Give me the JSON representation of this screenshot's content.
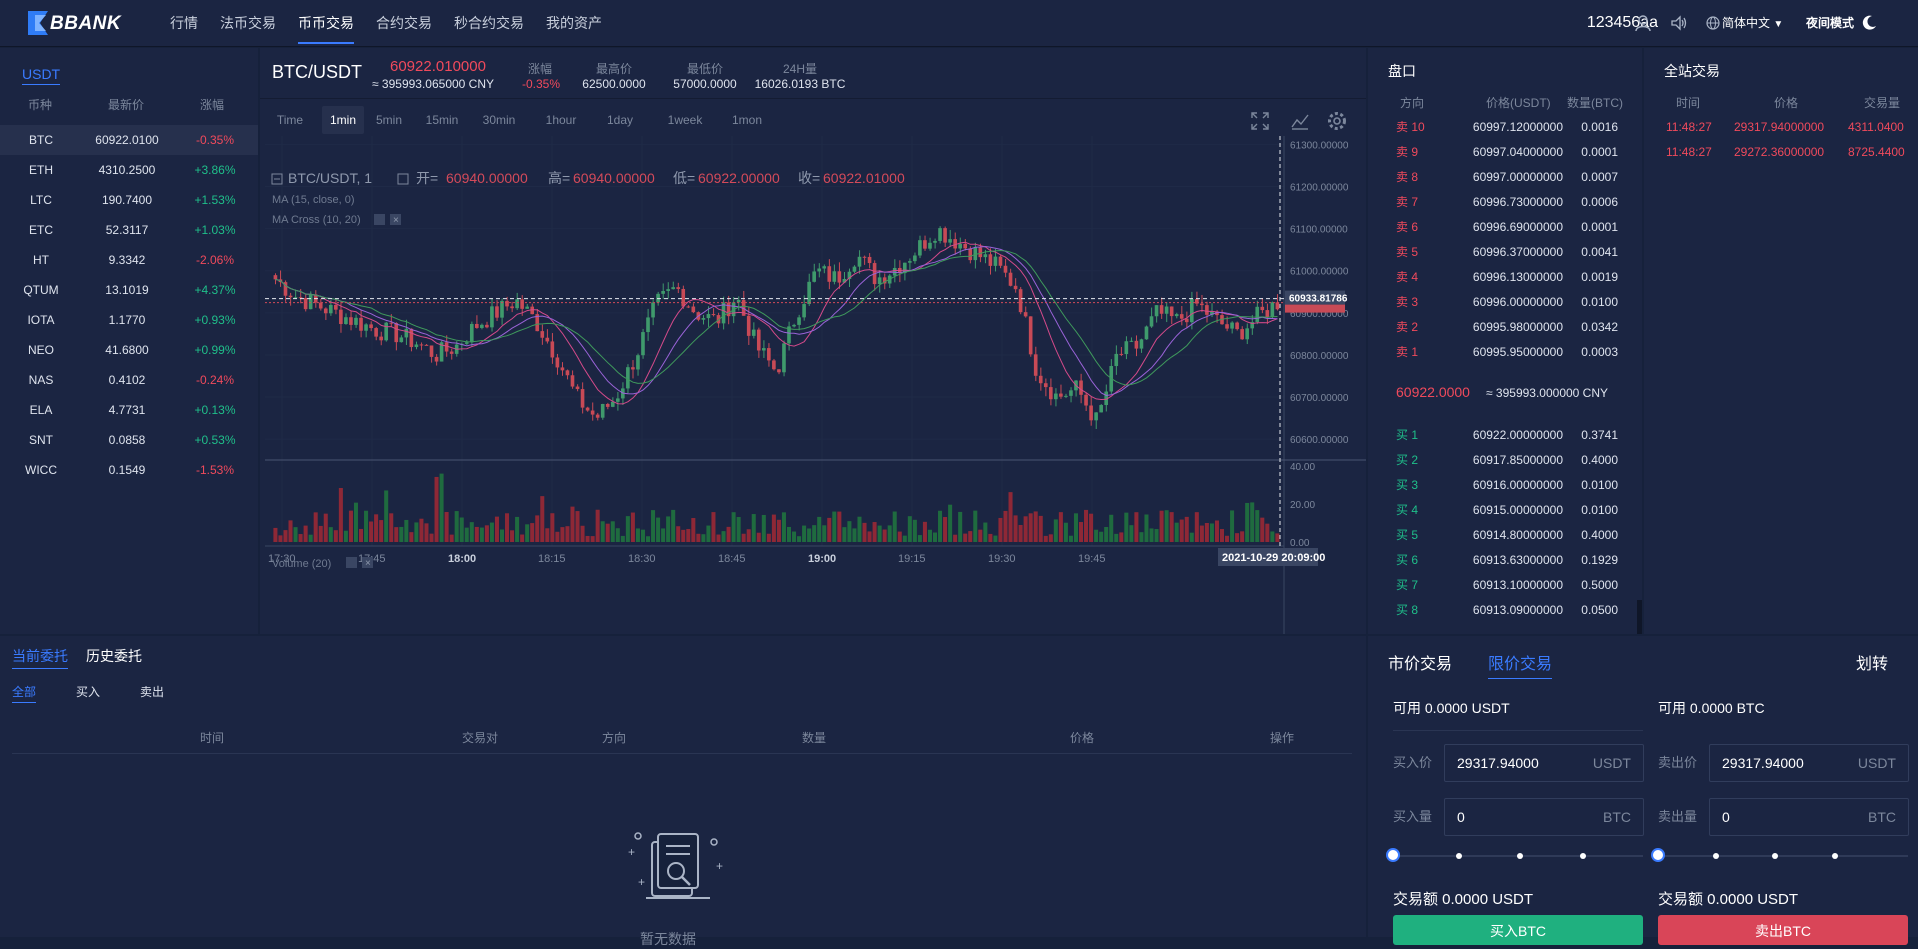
{
  "brand": {
    "name": "BBANK"
  },
  "nav": {
    "items": [
      {
        "label": "行情"
      },
      {
        "label": "法币交易"
      },
      {
        "label": "币币交易"
      },
      {
        "label": "合约交易"
      },
      {
        "label": "秒合约交易"
      },
      {
        "label": "我的资产"
      }
    ],
    "active_index": 2
  },
  "header": {
    "username": "123456aa",
    "language": "简体中文",
    "theme_label": "夜间模式"
  },
  "colors": {
    "up": "#1fbf8a",
    "down": "#f04a5c",
    "accent": "#3a7bff"
  },
  "market_list": {
    "tab": "USDT",
    "columns": [
      "币种",
      "最新价",
      "涨幅"
    ],
    "rows": [
      {
        "symbol": "BTC",
        "price": "60922.0100",
        "change": "-0.35%",
        "dir": "down"
      },
      {
        "symbol": "ETH",
        "price": "4310.2500",
        "change": "+3.86%",
        "dir": "up"
      },
      {
        "symbol": "LTC",
        "price": "190.7400",
        "change": "+1.53%",
        "dir": "up"
      },
      {
        "symbol": "ETC",
        "price": "52.3117",
        "change": "+1.03%",
        "dir": "up"
      },
      {
        "symbol": "HT",
        "price": "9.3342",
        "change": "-2.06%",
        "dir": "down"
      },
      {
        "symbol": "QTUM",
        "price": "13.1019",
        "change": "+4.37%",
        "dir": "up"
      },
      {
        "symbol": "IOTA",
        "price": "1.1770",
        "change": "+0.93%",
        "dir": "up"
      },
      {
        "symbol": "NEO",
        "price": "41.6800",
        "change": "+0.99%",
        "dir": "up"
      },
      {
        "symbol": "NAS",
        "price": "0.4102",
        "change": "-0.24%",
        "dir": "down"
      },
      {
        "symbol": "ELA",
        "price": "4.7731",
        "change": "+0.13%",
        "dir": "up"
      },
      {
        "symbol": "SNT",
        "price": "0.0858",
        "change": "+0.53%",
        "dir": "up"
      },
      {
        "symbol": "WICC",
        "price": "0.1549",
        "change": "-1.53%",
        "dir": "down"
      }
    ]
  },
  "ticker": {
    "pair": "BTC/USDT",
    "price": "60922.010000",
    "price_cny": "≈ 395993.065000 CNY",
    "change_label": "涨幅",
    "change": "-0.35%",
    "high_label": "最高价",
    "high": "62500.0000",
    "low_label": "最低价",
    "low": "57000.0000",
    "volume_label": "24H量",
    "volume": "16026.0193 BTC"
  },
  "timeframes": [
    "Time",
    "1min",
    "5min",
    "15min",
    "30min",
    "1hour",
    "1day",
    "1week",
    "1mon"
  ],
  "timeframe_active": 1,
  "chart_data": {
    "type": "candlestick",
    "legend": {
      "symbol": "BTC/USDT, 1",
      "open_label": "开=",
      "open": "60940.00000",
      "high_label": "高=",
      "high": "60940.00000",
      "low_label": "低=",
      "low": "60922.00000",
      "close_label": "收=",
      "close": "60922.01000",
      "ma_study": "MA (15, close, 0)",
      "ma_cross_study": "MA Cross (10, 20)",
      "volume_study": "Volume (20)"
    },
    "price_axis": [
      "61300.00000",
      "61200.00000",
      "61100.00000",
      "61000.00000",
      "60900.00000",
      "60800.00000",
      "60700.00000",
      "60600.00000"
    ],
    "price_ticks": [
      61300,
      61200,
      61100,
      61000,
      60900,
      60800,
      60700,
      60600
    ],
    "price_range": [
      60560,
      61320
    ],
    "volume_axis": [
      "40.00",
      "20.00",
      "0.00"
    ],
    "volume_ticks": [
      40,
      20,
      0
    ],
    "volume_range": [
      0,
      40
    ],
    "time_axis": [
      "17:30",
      "17:45",
      "18:00",
      "18:15",
      "18:30",
      "18:45",
      "19:00",
      "19:15",
      "19:30",
      "19:45"
    ],
    "crosshair_price": "60933.81786",
    "crosshair_time": "2021-10-29 20:09:00",
    "anchors": [
      60980,
      60940,
      60920,
      60900,
      60880,
      60860,
      60850,
      60830,
      60800,
      60820,
      60870,
      60900,
      60930,
      60880,
      60800,
      60700,
      60650,
      60700,
      60800,
      60920,
      60960,
      60900,
      60880,
      60940,
      60820,
      60760,
      60900,
      61000,
      60980,
      61040,
      60980,
      61010,
      61050,
      61100,
      61070,
      61040,
      61010,
      60960,
      60760,
      60700,
      60720,
      60640,
      60800,
      60820,
      60900,
      60880,
      60920,
      60880,
      60850,
      60890,
      60925
    ]
  },
  "orderbook": {
    "title": "盘口",
    "columns": [
      "方向",
      "价格(USDT)",
      "数量(BTC)"
    ],
    "asks": [
      {
        "side": "卖 10",
        "price": "60997.12000000",
        "amount": "0.0016"
      },
      {
        "side": "卖 9",
        "price": "60997.04000000",
        "amount": "0.0001"
      },
      {
        "side": "卖 8",
        "price": "60997.00000000",
        "amount": "0.0007"
      },
      {
        "side": "卖 7",
        "price": "60996.73000000",
        "amount": "0.0006"
      },
      {
        "side": "卖 6",
        "price": "60996.69000000",
        "amount": "0.0001"
      },
      {
        "side": "卖 5",
        "price": "60996.37000000",
        "amount": "0.0041"
      },
      {
        "side": "卖 4",
        "price": "60996.13000000",
        "amount": "0.0019"
      },
      {
        "side": "卖 3",
        "price": "60996.00000000",
        "amount": "0.0100"
      },
      {
        "side": "卖 2",
        "price": "60995.98000000",
        "amount": "0.0342"
      },
      {
        "side": "卖 1",
        "price": "60995.95000000",
        "amount": "0.0003"
      }
    ],
    "last_price": "60922.0000",
    "last_price_cny": "≈ 395993.000000 CNY",
    "bids": [
      {
        "side": "买 1",
        "price": "60922.00000000",
        "amount": "0.3741"
      },
      {
        "side": "买 2",
        "price": "60917.85000000",
        "amount": "0.4000"
      },
      {
        "side": "买 3",
        "price": "60916.00000000",
        "amount": "0.0100"
      },
      {
        "side": "买 4",
        "price": "60915.00000000",
        "amount": "0.0100"
      },
      {
        "side": "买 5",
        "price": "60914.80000000",
        "amount": "0.4000"
      },
      {
        "side": "买 6",
        "price": "60913.63000000",
        "amount": "0.1929"
      },
      {
        "side": "买 7",
        "price": "60913.10000000",
        "amount": "0.5000"
      },
      {
        "side": "买 8",
        "price": "60913.09000000",
        "amount": "0.0500"
      }
    ]
  },
  "trades": {
    "title": "全站交易",
    "columns": [
      "时间",
      "价格",
      "交易量"
    ],
    "rows": [
      {
        "time": "11:48:27",
        "price": "29317.94000000",
        "amount": "4311.0400"
      },
      {
        "time": "11:48:27",
        "price": "29272.36000000",
        "amount": "8725.4400"
      }
    ]
  },
  "orders": {
    "tabs": [
      "当前委托",
      "历史委托"
    ],
    "filters": [
      "全部",
      "买入",
      "卖出"
    ],
    "columns": [
      "时间",
      "交易对",
      "方向",
      "数量",
      "价格",
      "操作"
    ],
    "empty_text": "暂无数据"
  },
  "trade_form": {
    "tabs": [
      "市价交易",
      "限价交易"
    ],
    "transfer": "划转",
    "buy": {
      "available": "可用 0.0000 USDT",
      "price_label": "买入价",
      "price_value": "29317.94000",
      "price_unit": "USDT",
      "amount_label": "买入量",
      "amount_value": "0",
      "amount_unit": "BTC",
      "total": "交易额 0.0000 USDT",
      "button": "买入BTC"
    },
    "sell": {
      "available": "可用 0.0000 BTC",
      "price_label": "卖出价",
      "price_value": "29317.94000",
      "price_unit": "USDT",
      "amount_label": "卖出量",
      "amount_value": "0",
      "amount_unit": "BTC",
      "total": "交易额 0.0000 USDT",
      "button": "卖出BTC"
    }
  }
}
